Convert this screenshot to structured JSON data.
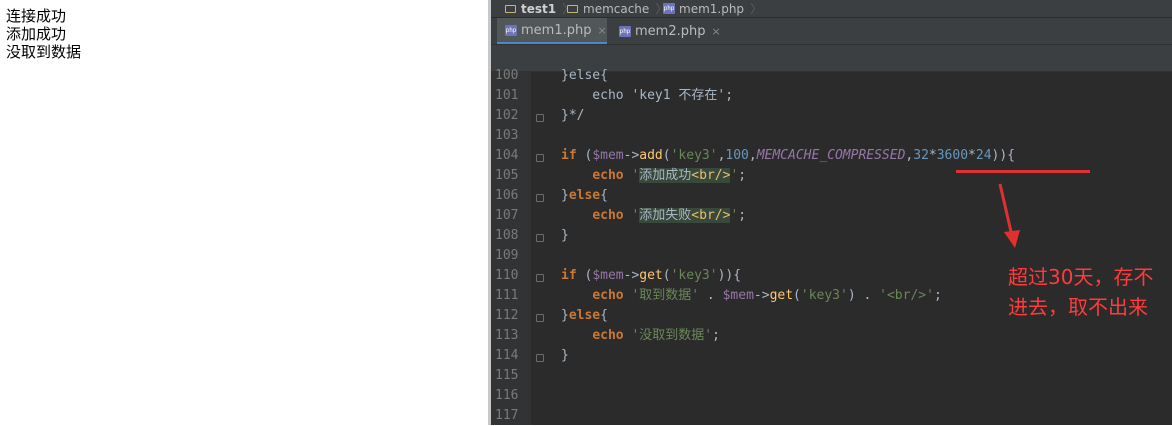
{
  "browser": {
    "lines": [
      "连接成功",
      "添加成功",
      "没取到数据"
    ]
  },
  "ide": {
    "breadcrumb": [
      "test1",
      "memcache",
      "mem1.php"
    ],
    "tabs": [
      {
        "label": "mem1.php",
        "close": "×",
        "active": true
      },
      {
        "label": "mem2.php",
        "close": "×",
        "active": false
      }
    ],
    "line_numbers": [
      "100",
      "101",
      "102",
      "103",
      "104",
      "105",
      "106",
      "107",
      "108",
      "109",
      "110",
      "111",
      "112",
      "113",
      "114",
      "115",
      "116",
      "117"
    ],
    "php_icon_text": "php"
  },
  "annotation": {
    "text": "超过30天，存不进去，取不出来",
    "color": "#ff3b3b"
  },
  "colors": {
    "keyword": "#cc7832",
    "string": "#6a8759",
    "variable": "#9876aa",
    "function": "#ffc66d",
    "number": "#6897bb",
    "editor_bg": "#2b2b2b"
  }
}
